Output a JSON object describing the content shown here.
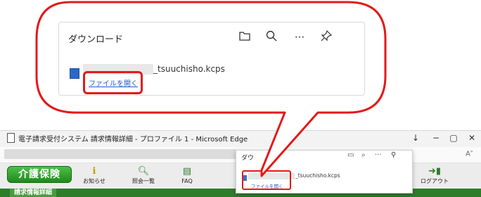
{
  "callout": {
    "panel_title": "ダウンロード",
    "icons": [
      "folder-icon",
      "search-icon",
      "more-icon",
      "pin-icon"
    ],
    "file_name": "_tsuuchisho.kcps",
    "open_file_link": "ファイルを開く"
  },
  "browser": {
    "title": "電子請求受付システム 請求情報詳細 - プロファイル 1 - Microsoft Edge",
    "window_controls": [
      "↓",
      "−",
      "▢",
      "✕"
    ],
    "reader_icon": "A̵",
    "site_nav": {
      "kaigo_button": "介護保険",
      "items": [
        {
          "icon": "info-icon",
          "label": "お知らせ"
        },
        {
          "icon": "search-icon",
          "label": "照会一覧"
        },
        {
          "icon": "faq-icon",
          "label": "FAQ"
        },
        {
          "icon": "logout-icon",
          "label": "ログアウト"
        }
      ],
      "section_label": "請求情報詳細"
    },
    "download_panel": {
      "title": "ダウ",
      "file_name": "_tsuuchisho.kcps",
      "open_file_link": "ファイルを開く"
    }
  },
  "colors": {
    "highlight": "#e21a1a",
    "link": "#1a5fd1",
    "kaigo_green": "#2f9a2a"
  }
}
